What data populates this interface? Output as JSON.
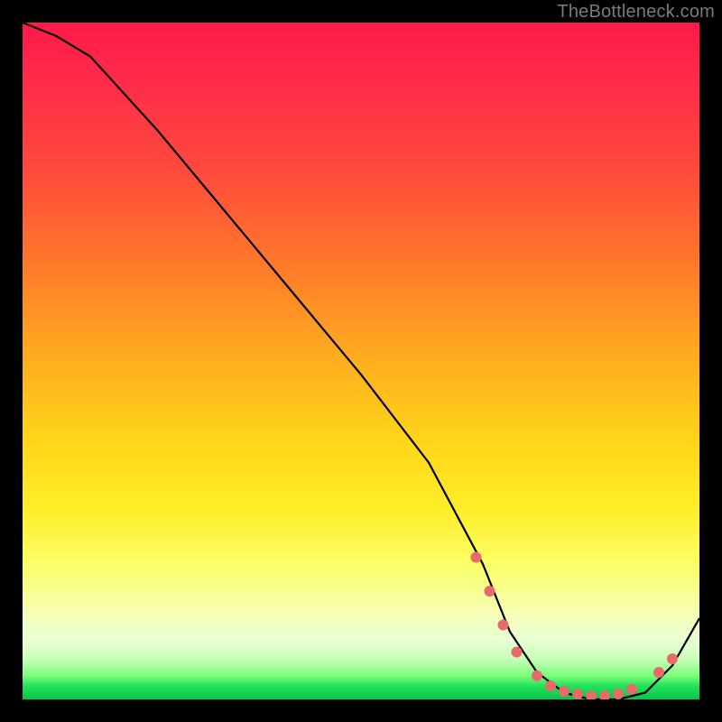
{
  "watermark": "TheBottleneck.com",
  "chart_data": {
    "type": "line",
    "title": "",
    "xlabel": "",
    "ylabel": "",
    "xlim": [
      0,
      100
    ],
    "ylim": [
      0,
      100
    ],
    "series": [
      {
        "name": "curve",
        "x": [
          0,
          5,
          10,
          20,
          30,
          40,
          50,
          60,
          68,
          72,
          76,
          80,
          84,
          88,
          92,
          96,
          100
        ],
        "y": [
          100,
          98,
          95,
          84,
          72,
          60,
          48,
          35,
          20,
          10,
          4,
          1,
          0,
          0,
          1,
          5,
          12
        ]
      }
    ],
    "dots": [
      {
        "x": 67,
        "y": 21
      },
      {
        "x": 69,
        "y": 16
      },
      {
        "x": 71,
        "y": 11
      },
      {
        "x": 73,
        "y": 7
      },
      {
        "x": 76,
        "y": 3.5
      },
      {
        "x": 78,
        "y": 2
      },
      {
        "x": 80,
        "y": 1.2
      },
      {
        "x": 82,
        "y": 0.8
      },
      {
        "x": 84,
        "y": 0.5
      },
      {
        "x": 86,
        "y": 0.5
      },
      {
        "x": 88,
        "y": 0.8
      },
      {
        "x": 90,
        "y": 1.5
      },
      {
        "x": 94,
        "y": 4
      },
      {
        "x": 96,
        "y": 6
      }
    ],
    "gradient_stops": [
      {
        "pos": 0,
        "color": "#ff1a47"
      },
      {
        "pos": 22,
        "color": "#ff4a3c"
      },
      {
        "pos": 50,
        "color": "#ffae1f"
      },
      {
        "pos": 72,
        "color": "#ffee2a"
      },
      {
        "pos": 91,
        "color": "#eaffd4"
      },
      {
        "pos": 100,
        "color": "#07c44a"
      }
    ],
    "dot_color": "#e86a6a"
  }
}
